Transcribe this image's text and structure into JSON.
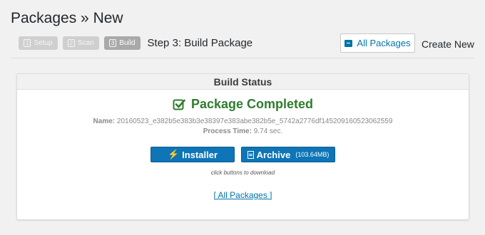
{
  "page": {
    "title": "Packages » New"
  },
  "steps": [
    {
      "num": "1",
      "label": "Setup"
    },
    {
      "num": "2",
      "label": "Scan"
    },
    {
      "num": "3",
      "label": "Build"
    }
  ],
  "step_caption": "Step 3: Build Package",
  "header_actions": {
    "all_packages": "All Packages",
    "create_new": "Create New"
  },
  "status": {
    "title": "Build Status",
    "completed": "Package Completed",
    "name_label": "Name:",
    "name_value": "20160523_e382b5e383b3e38397e383abe382b5e_5742a2776df145209160523062559",
    "time_label": "Process Time:",
    "time_value": "9.74 sec.",
    "installer_label": "Installer",
    "archive_label": "Archive",
    "archive_size": "(103.64MB)",
    "hint": "click buttons to download",
    "all_link": "[ All Packages ]"
  },
  "colors": {
    "accent": "#0073aa",
    "button": "#0e75b6",
    "success": "#2e7d2e"
  },
  "icons": [
    "package-icon",
    "check-icon",
    "bolt-icon",
    "document-icon"
  ]
}
